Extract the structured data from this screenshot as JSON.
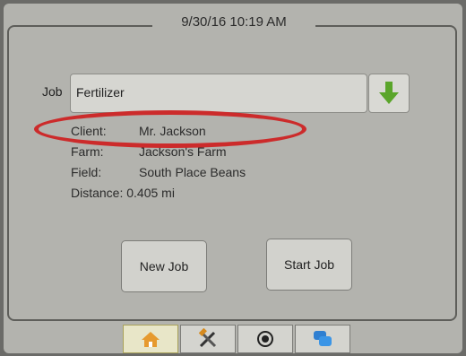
{
  "header": {
    "datetime": "9/30/16 10:19 AM"
  },
  "job": {
    "label": "Job",
    "value": "Fertilizer",
    "dropdown_icon": "green-down-arrow-icon"
  },
  "details": [
    {
      "label": "Client:",
      "value": "Mr. Jackson"
    },
    {
      "label": "Farm:",
      "value": "Jackson's Farm"
    },
    {
      "label": "Field:",
      "value": "South Place Beans"
    },
    {
      "label": "Distance:",
      "value": "0.405 mi"
    }
  ],
  "buttons": {
    "new_job": "New Job",
    "start_job": "Start Job"
  },
  "tabs": [
    {
      "icon": "home-icon",
      "active": true
    },
    {
      "icon": "tools-icon",
      "active": false
    },
    {
      "icon": "gps-target-icon",
      "active": false
    },
    {
      "icon": "chat-bubbles-icon",
      "active": false
    }
  ],
  "colors": {
    "highlight": "#cc2b2b",
    "arrow": "#5aa52a",
    "active_tab": "#e8e6c8"
  }
}
